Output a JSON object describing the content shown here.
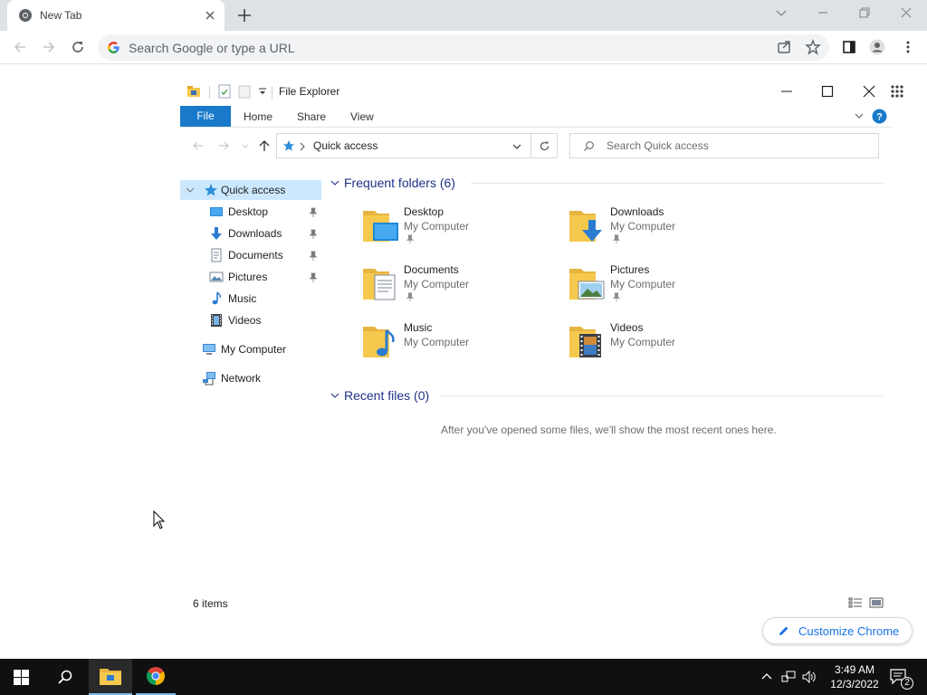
{
  "browser": {
    "tab_title": "New Tab",
    "omnibox_placeholder": "Search Google or type a URL",
    "customize_label": "Customize Chrome"
  },
  "explorer": {
    "window_title": "File Explorer",
    "ribbon": {
      "file": "File",
      "home": "Home",
      "share": "Share",
      "view": "View"
    },
    "address_path": "Quick access",
    "search_placeholder": "Search Quick access",
    "nav": {
      "quick_access": "Quick access",
      "pinned": [
        {
          "label": "Desktop",
          "icon": "desktop-icon"
        },
        {
          "label": "Downloads",
          "icon": "downloads-icon"
        },
        {
          "label": "Documents",
          "icon": "documents-icon"
        },
        {
          "label": "Pictures",
          "icon": "pictures-icon"
        },
        {
          "label": "Music",
          "icon": "music-icon"
        },
        {
          "label": "Videos",
          "icon": "videos-icon"
        }
      ],
      "my_computer": "My Computer",
      "network": "Network"
    },
    "frequent_header": "Frequent folders (6)",
    "folders": [
      {
        "name": "Desktop",
        "location": "My Computer",
        "pinned": true
      },
      {
        "name": "Downloads",
        "location": "My Computer",
        "pinned": true
      },
      {
        "name": "Documents",
        "location": "My Computer",
        "pinned": true
      },
      {
        "name": "Pictures",
        "location": "My Computer",
        "pinned": true
      },
      {
        "name": "Music",
        "location": "My Computer",
        "pinned": false
      },
      {
        "name": "Videos",
        "location": "My Computer",
        "pinned": false
      }
    ],
    "recent_header": "Recent files (0)",
    "recent_empty": "After you've opened some files, we'll show the most recent ones here.",
    "status_items": "6 items"
  },
  "taskbar": {
    "time": "3:49 AM",
    "date": "12/3/2022",
    "notification_count": "2"
  },
  "colors": {
    "accent": "#1979ca",
    "folder": "#f5c94e",
    "section_header": "#1e3287",
    "chrome_link": "#1a73e8"
  }
}
